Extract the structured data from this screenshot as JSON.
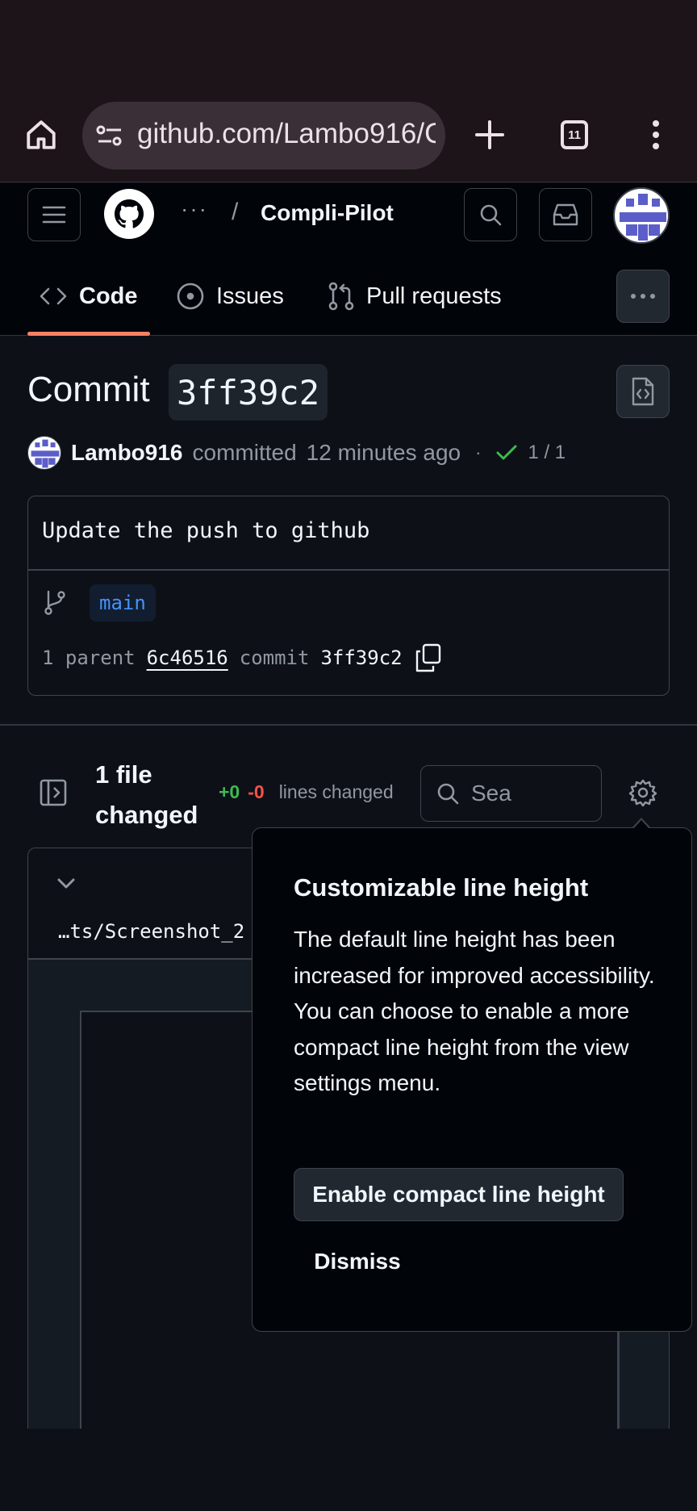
{
  "browser": {
    "url": "github.com/Lambo916/C",
    "tab_count": "11"
  },
  "header": {
    "breadcrumb_dots": "···",
    "breadcrumb_sep": "/",
    "repo_name": "Compli-Pilot"
  },
  "nav": {
    "tabs": [
      {
        "label": "Code",
        "active": true
      },
      {
        "label": "Issues",
        "active": false
      },
      {
        "label": "Pull requests",
        "active": false
      }
    ]
  },
  "commit": {
    "title_prefix": "Commit",
    "sha": "3ff39c2",
    "author": "Lambo916",
    "action": "committed",
    "time": "12 minutes ago",
    "separator": "·",
    "checks": "1 / 1",
    "message": "Update the push to github",
    "branch": "main",
    "parent_label": "1 parent",
    "parent_sha": "6c46516",
    "commit_label": "commit",
    "commit_sha": "3ff39c2"
  },
  "files": {
    "title": "1 file changed",
    "additions": "+0",
    "deletions": "-0",
    "lines_changed": "lines changed",
    "search_placeholder": "Sea",
    "file_path": "…ts/Screenshot_2"
  },
  "popover": {
    "title": "Customizable line height",
    "body": "The default line height has been increased for improved accessibility. You can choose to enable a more compact line height from the view settings menu.",
    "primary_button": "Enable compact line height",
    "dismiss_button": "Dismiss"
  },
  "colors": {
    "accent_tab_underline": "#f78166",
    "additions": "#3fb950",
    "deletions": "#f85149",
    "link_blue": "#4493f8",
    "check_green": "#3fb950"
  }
}
